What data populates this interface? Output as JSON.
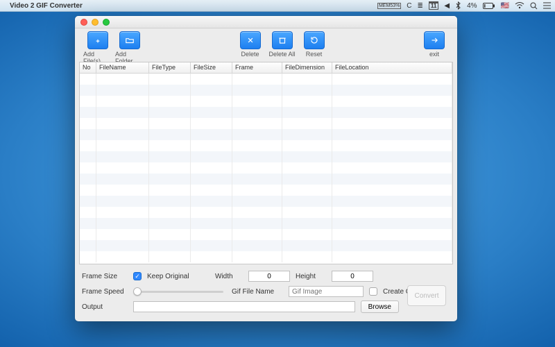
{
  "menubar": {
    "app_title": "Video 2 GIF Converter",
    "mem_label": "MEM",
    "mem_pct": "53%",
    "battery": "4%",
    "flag": "🇺🇸"
  },
  "toolbar": {
    "add_files": "Add File(s)",
    "add_folder": "Add Folder",
    "delete": "Delete",
    "delete_all": "Delete All",
    "reset": "Reset",
    "exit": "exit"
  },
  "table": {
    "cols": {
      "no": "No",
      "filename": "FileName",
      "filetype": "FileType",
      "filesize": "FileSize",
      "frame": "Frame",
      "filedimension": "FileDimension",
      "filelocation": "FileLocation"
    }
  },
  "panel": {
    "frame_size": "Frame Size",
    "keep_original": "Keep Original",
    "width": "Width",
    "height": "Height",
    "width_val": "0",
    "height_val": "0",
    "frame_speed": "Frame Speed",
    "gif_file_name": "Gif File Name",
    "gif_placeholder": "Gif Image",
    "create_one_gif": "Create One GIF",
    "output": "Output",
    "browse": "Browse",
    "convert": "Convert"
  }
}
